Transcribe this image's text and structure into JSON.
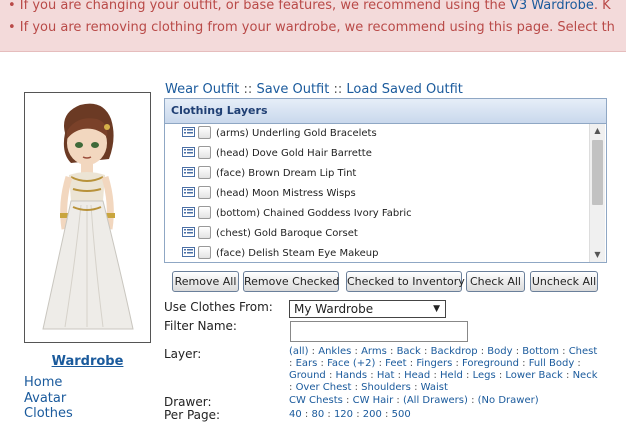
{
  "notice": {
    "line1_prefix": "• If you are changing your outfit, or base features, we recommend using the ",
    "line1_link": "V3 Wardrobe",
    "line1_suffix": ". K",
    "line2": "• If you are removing clothing from your wardrobe, we recommend using this page. Select th"
  },
  "outfit_links": {
    "wear": "Wear Outfit",
    "save": "Save Outfit",
    "load": "Load Saved Outfit",
    "separator": "::"
  },
  "layers": {
    "header": "Clothing Layers",
    "items": [
      "(arms) Underling Gold Bracelets",
      "(head) Dove Gold Hair Barrette",
      "(face) Brown Dream Lip Tint",
      "(head) Moon Mistress Wisps",
      "(bottom) Chained Goddess Ivory Fabric",
      "(chest) Gold Baroque Corset",
      "(face) Delish Steam Eye Makeup"
    ]
  },
  "buttons": {
    "remove_all": "Remove All",
    "remove_checked": "Remove Checked",
    "checked_to_inventory": "Checked to Inventory",
    "check_all": "Check All",
    "uncheck_all": "Uncheck All"
  },
  "form": {
    "use_clothes_label": "Use Clothes From:",
    "use_clothes_value": "My Wardrobe",
    "filter_label": "Filter Name:",
    "filter_value": "",
    "layer_label": "Layer:",
    "layer_options": [
      "(all)",
      "Ankles",
      "Arms",
      "Back",
      "Backdrop",
      "Body",
      "Bottom",
      "Chest",
      "Ears",
      "Face (+2)",
      "Feet",
      "Fingers",
      "Foreground",
      "Full Body",
      "Ground",
      "Hands",
      "Hat",
      "Head",
      "Held",
      "Legs",
      "Lower Back",
      "Neck",
      "Over Chest",
      "Shoulders",
      "Waist"
    ],
    "drawer_label": "Drawer:",
    "drawer_options": [
      "CW Chests",
      "CW Hair",
      "(All Drawers)",
      "(No Drawer)"
    ],
    "perpage_label": "Per Page:",
    "perpage_options": [
      "40",
      "80",
      "120",
      "200",
      "500"
    ]
  },
  "sidebar": {
    "title": "Wardrobe",
    "links": [
      "Home",
      "Avatar",
      "Clothes"
    ]
  },
  "colors": {
    "link": "#1a5a9c",
    "notice_bg": "#f3dada",
    "notice_text": "#b94a48",
    "panel_border": "#8fa7c4"
  }
}
